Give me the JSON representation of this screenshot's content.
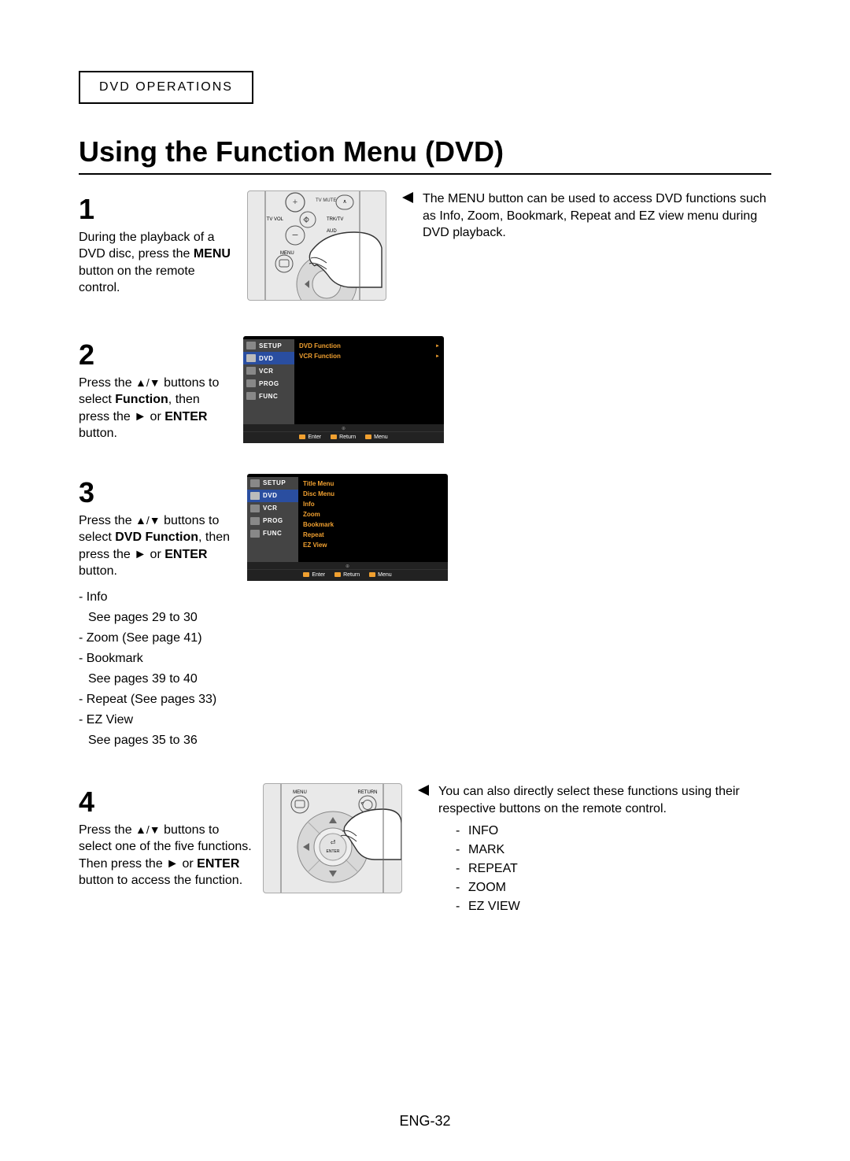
{
  "header": {
    "section": "DVD OPERATIONS"
  },
  "title": "Using the Function Menu (DVD)",
  "step1": {
    "num": "1",
    "prefix": "During the playback of a DVD disc, press the ",
    "bold1": "MENU",
    "suffix": " button on the remote control.",
    "note": "The MENU button can be used to access DVD functions such as Info, Zoom, Bookmark, Repeat and EZ view menu during DVD playback.",
    "remote": {
      "tv_mute": "TV MUTE",
      "tv_vol": "TV VOL",
      "trk": "TRK/TV",
      "aud": "AUD",
      "menu": "MENU",
      "mute_icon_name": "mute-icon"
    }
  },
  "step2": {
    "num": "2",
    "prefix": "Press the ",
    "arrows": "▲/▼",
    "mid": " buttons to select ",
    "bold1": "Function",
    "mid2": ", then press the ",
    "play": "►",
    "or_enter": " or ",
    "bold2": "ENTER",
    "suffix": " button.",
    "osd": {
      "tabs": [
        "SETUP",
        "DVD",
        "VCR",
        "PROG",
        "FUNC"
      ],
      "items": [
        {
          "label": "DVD Function",
          "arrow": true
        },
        {
          "label": "VCR Function",
          "arrow": true
        }
      ],
      "footer": [
        "Enter",
        "Return",
        "Menu"
      ]
    }
  },
  "step3": {
    "num": "3",
    "prefix": "Press the ",
    "arrows": "▲/▼",
    "mid": " buttons to select ",
    "bold1": "DVD Function",
    "mid2": ", then press the ",
    "play": "►",
    "or_enter": " or ",
    "bold2": "ENTER",
    "suffix": " button.",
    "subitems": [
      "Info",
      "See pages 29 to 30",
      "Zoom (See page 41)",
      "Bookmark",
      "See pages 39 to 40",
      "Repeat (See pages 33)",
      "EZ View",
      "See pages 35 to 36"
    ],
    "osd": {
      "tabs": [
        "SETUP",
        "DVD",
        "VCR",
        "PROG",
        "FUNC"
      ],
      "items": [
        {
          "label": "Title Menu"
        },
        {
          "label": "Disc Menu"
        },
        {
          "label": "Info"
        },
        {
          "label": "Zoom"
        },
        {
          "label": "Bookmark"
        },
        {
          "label": "Repeat"
        },
        {
          "label": "EZ View"
        }
      ],
      "footer": [
        "Enter",
        "Return",
        "Menu"
      ]
    }
  },
  "step4": {
    "num": "4",
    "prefix": "Press the ",
    "arrows": "▲/▼",
    "mid": " buttons to select one of the five functions. Then press the ",
    "play": "►",
    "or_enter": " or ",
    "bold1": "ENTER",
    "suffix": " button to access the function.",
    "note_pre": "You can also directly select these functions using their respective buttons on the remote control.",
    "note_items": [
      "INFO",
      "MARK",
      "REPEAT",
      "ZOOM",
      "EZ VIEW"
    ],
    "remote": {
      "menu": "MENU",
      "return": "RETURN",
      "enter": "ENTER"
    }
  },
  "page_number": "ENG-32"
}
